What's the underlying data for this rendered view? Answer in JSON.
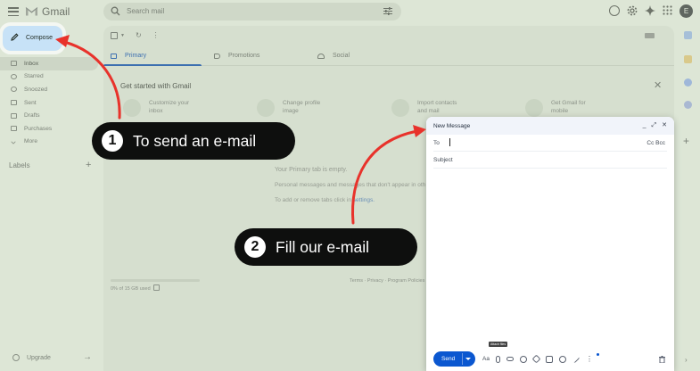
{
  "app": {
    "name": "Gmail"
  },
  "search": {
    "placeholder": "Search mail"
  },
  "avatar": {
    "initial": "E"
  },
  "compose_button": {
    "label": "Compose"
  },
  "sidebar": {
    "items": [
      {
        "label": "Inbox",
        "active": true
      },
      {
        "label": "Starred",
        "active": false
      },
      {
        "label": "Snoozed",
        "active": false
      },
      {
        "label": "Sent",
        "active": false
      },
      {
        "label": "Drafts",
        "active": false
      },
      {
        "label": "Purchases",
        "active": false
      },
      {
        "label": "More",
        "active": false
      }
    ],
    "labels_heading": "Labels",
    "upgrade_label": "Upgrade"
  },
  "tabs": [
    {
      "label": "Primary",
      "selected": true
    },
    {
      "label": "Promotions",
      "selected": false
    },
    {
      "label": "Social",
      "selected": false
    }
  ],
  "get_started": {
    "title": "Get started with Gmail",
    "cards": [
      {
        "line1": "Customize your",
        "line2": "inbox"
      },
      {
        "line1": "Change profile",
        "line2": "image"
      },
      {
        "line1": "Import contacts",
        "line2": "and mail"
      },
      {
        "line1": "Get Gmail for",
        "line2": "mobile"
      }
    ]
  },
  "empty_state": {
    "line1": "Your Primary tab is empty.",
    "line2": "Personal messages and messages that don't appear in oth",
    "line3_prefix": "To add or remove tabs click in",
    "line3_link": "settings."
  },
  "storage": {
    "label": "0% of 15 GB used",
    "used_fraction": 0
  },
  "footer": {
    "text": "Terms · Privacy · Program Policies"
  },
  "compose_window": {
    "title": "New Message",
    "to_label": "To",
    "cc_bcc": "Cc Bcc",
    "subject_placeholder": "Subject",
    "send_label": "Send",
    "format_label": "Aa",
    "tooltip": "Attach files"
  },
  "callouts": [
    {
      "number": "1",
      "text": "To send an e-mail"
    },
    {
      "number": "2",
      "text": "Fill our e-mail"
    }
  ],
  "colors": {
    "background": "#dde6d6",
    "compose_highlight": "#c7e2f7",
    "send_button": "#0b57d0",
    "arrow": "#e8322b",
    "callout_bg": "#0e0f0e"
  }
}
